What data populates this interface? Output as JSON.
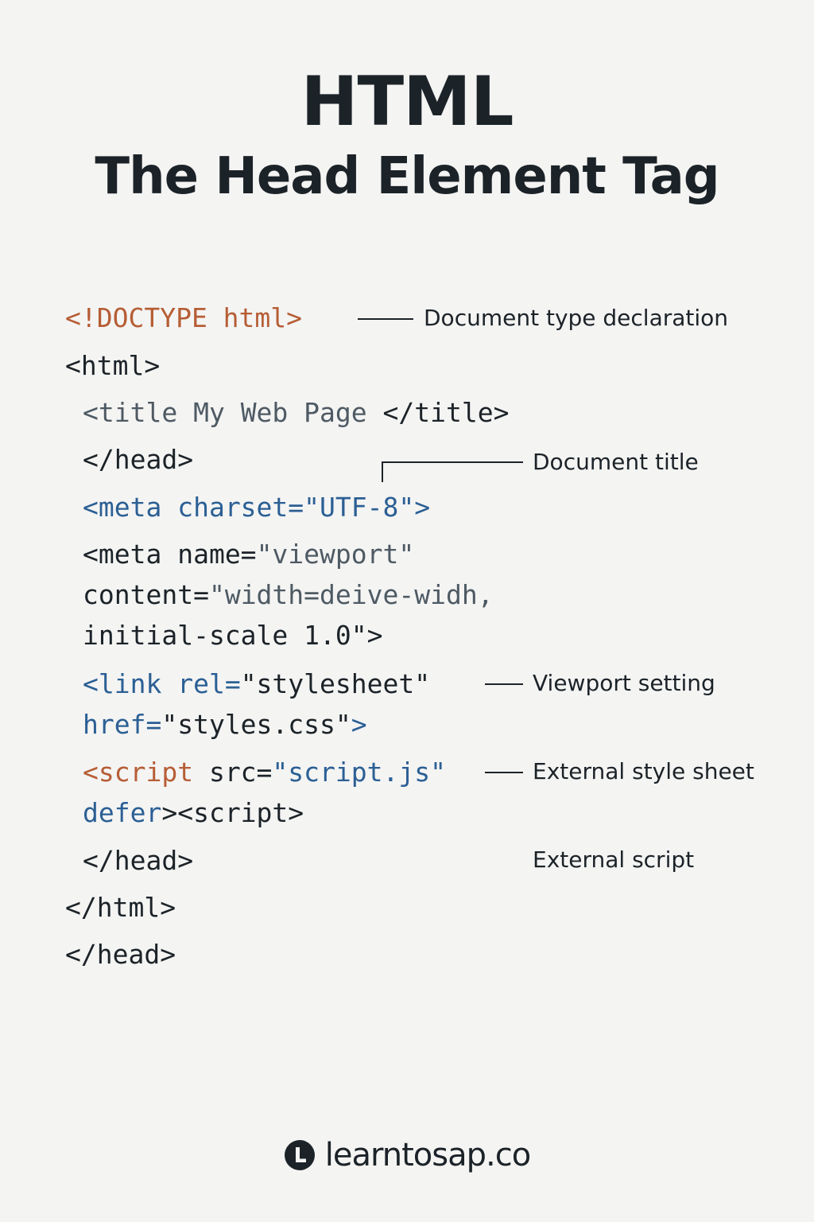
{
  "header": {
    "title": "HTML",
    "subtitle": "The Head Element Tag"
  },
  "code": {
    "doctype": "<!DOCTYPE html>",
    "html_open": "<html>",
    "title_open": "<title",
    "title_text": " My Web Page ",
    "title_close": "</title>",
    "head_close_1": "</head>",
    "meta1_tag": "<meta",
    "meta1_attr": " charset=",
    "meta1_value": "\"UTF-8\"",
    "meta1_end": ">",
    "meta2_tag": "<meta",
    "meta2_attr": " name=",
    "meta2_value": "\"viewport\"",
    "meta2_line2_attr": "content=",
    "meta2_line2_value": "\"width=deive-widh,",
    "meta2_line3": "initial-scale 1.0\">",
    "link_tag": "<link",
    "link_attr": " rel=",
    "link_value": "\"stylesheet\"",
    "link_line2_attr": "href=",
    "link_line2_value": "\"styles.css\"",
    "link_line2_end": ">",
    "script_tag": "<script",
    "script_attr": " src=",
    "script_value": "\"script.js\"",
    "script_line2_attr": "defer",
    "script_line2_rest": "><script>",
    "head_close_2": "</head>",
    "html_close": "</html>",
    "head_close_3": "</head>"
  },
  "annotations": {
    "doctype": "Document type declaration",
    "title": "Document title",
    "viewport": "Viewport setting",
    "stylesheet": "External style sheet",
    "script": "External script"
  },
  "footer": {
    "brand": "learntosap.co",
    "logo_icon": "learntosap-logo-icon"
  }
}
